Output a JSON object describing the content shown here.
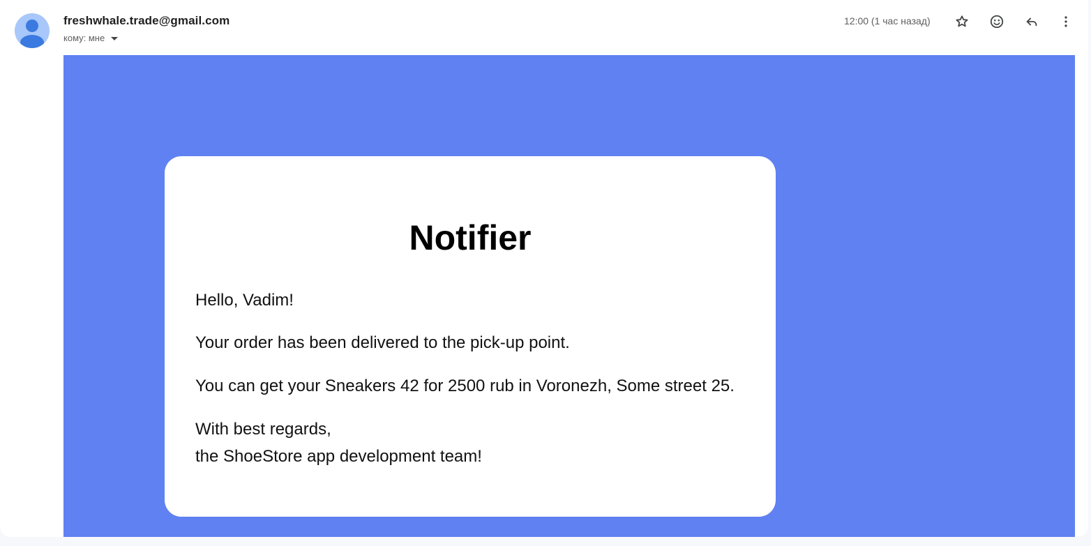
{
  "header": {
    "sender": "freshwhale.trade@gmail.com",
    "recipient_label": "кому: мне",
    "time": "12:00 (1 час назад)"
  },
  "icons": {
    "avatar": "person-icon",
    "star": "star-outline-icon",
    "emoji": "emoji-smile-icon",
    "reply": "reply-icon",
    "more": "more-vertical-icon"
  },
  "colors": {
    "email_background": "#6081f2",
    "card_background": "#ffffff",
    "avatar_background": "#a8c7fa",
    "avatar_figure": "#3b7ae0"
  },
  "email": {
    "title": "Notifier",
    "greeting": "Hello, Vadim!",
    "line_order": "Your order has been delivered to the pick-up point.",
    "line_pickup": "You can get your Sneakers 42 for 2500 rub in Voronezh, Some street 25.",
    "line_regards": "With best regards,",
    "line_team": "the ShoeStore app development team!"
  }
}
